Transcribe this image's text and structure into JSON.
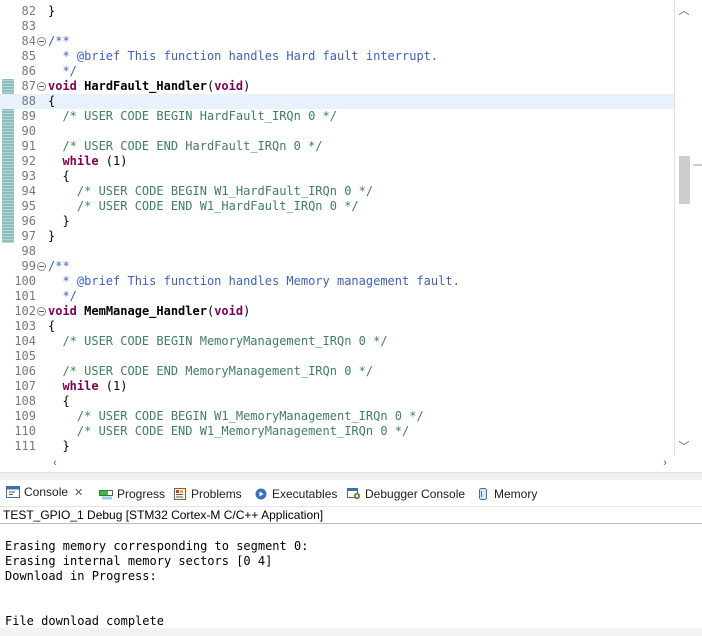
{
  "editor": {
    "lines": [
      {
        "n": "82",
        "fold": false,
        "current": false,
        "segs": [
          {
            "t": "}",
            "c": "plain"
          }
        ]
      },
      {
        "n": "83",
        "fold": false,
        "current": false,
        "segs": []
      },
      {
        "n": "84",
        "fold": true,
        "current": false,
        "segs": [
          {
            "t": "/**",
            "c": "doc"
          }
        ]
      },
      {
        "n": "85",
        "fold": false,
        "current": false,
        "segs": [
          {
            "t": "  * @brief This function handles Hard fault interrupt.",
            "c": "doc"
          }
        ]
      },
      {
        "n": "86",
        "fold": false,
        "current": false,
        "segs": [
          {
            "t": "  */",
            "c": "doc"
          }
        ]
      },
      {
        "n": "87",
        "fold": true,
        "current": false,
        "segs": [
          {
            "t": "void",
            "c": "kw"
          },
          {
            "t": " ",
            "c": "plain"
          },
          {
            "t": "HardFault_Handler",
            "c": "fn"
          },
          {
            "t": "(",
            "c": "plain"
          },
          {
            "t": "void",
            "c": "kw"
          },
          {
            "t": ")",
            "c": "plain"
          }
        ]
      },
      {
        "n": "88",
        "fold": false,
        "current": true,
        "segs": [
          {
            "t": "{",
            "c": "plain"
          }
        ]
      },
      {
        "n": "89",
        "fold": false,
        "current": false,
        "segs": [
          {
            "t": "  /* USER CODE BEGIN HardFault_IRQn 0 */",
            "c": "comment"
          }
        ]
      },
      {
        "n": "90",
        "fold": false,
        "current": false,
        "segs": []
      },
      {
        "n": "91",
        "fold": false,
        "current": false,
        "segs": [
          {
            "t": "  /* USER CODE END HardFault_IRQn 0 */",
            "c": "comment"
          }
        ]
      },
      {
        "n": "92",
        "fold": false,
        "current": false,
        "segs": [
          {
            "t": "  ",
            "c": "plain"
          },
          {
            "t": "while",
            "c": "kw"
          },
          {
            "t": " (1)",
            "c": "plain"
          }
        ]
      },
      {
        "n": "93",
        "fold": false,
        "current": false,
        "segs": [
          {
            "t": "  {",
            "c": "plain"
          }
        ]
      },
      {
        "n": "94",
        "fold": false,
        "current": false,
        "segs": [
          {
            "t": "    /* USER CODE BEGIN W1_HardFault_IRQn 0 */",
            "c": "comment"
          }
        ]
      },
      {
        "n": "95",
        "fold": false,
        "current": false,
        "segs": [
          {
            "t": "    /* USER CODE END W1_HardFault_IRQn 0 */",
            "c": "comment"
          }
        ]
      },
      {
        "n": "96",
        "fold": false,
        "current": false,
        "segs": [
          {
            "t": "  }",
            "c": "plain"
          }
        ]
      },
      {
        "n": "97",
        "fold": false,
        "current": false,
        "segs": [
          {
            "t": "}",
            "c": "plain"
          }
        ]
      },
      {
        "n": "98",
        "fold": false,
        "current": false,
        "segs": []
      },
      {
        "n": "99",
        "fold": true,
        "current": false,
        "segs": [
          {
            "t": "/**",
            "c": "doc"
          }
        ]
      },
      {
        "n": "100",
        "fold": false,
        "current": false,
        "segs": [
          {
            "t": "  * @brief This function handles Memory management fault.",
            "c": "doc"
          }
        ]
      },
      {
        "n": "101",
        "fold": false,
        "current": false,
        "segs": [
          {
            "t": "  */",
            "c": "doc"
          }
        ]
      },
      {
        "n": "102",
        "fold": true,
        "current": false,
        "segs": [
          {
            "t": "void",
            "c": "kw"
          },
          {
            "t": " ",
            "c": "plain"
          },
          {
            "t": "MemManage_Handler",
            "c": "fn"
          },
          {
            "t": "(",
            "c": "plain"
          },
          {
            "t": "void",
            "c": "kw"
          },
          {
            "t": ")",
            "c": "plain"
          }
        ]
      },
      {
        "n": "103",
        "fold": false,
        "current": false,
        "segs": [
          {
            "t": "{",
            "c": "plain"
          }
        ]
      },
      {
        "n": "104",
        "fold": false,
        "current": false,
        "segs": [
          {
            "t": "  /* USER CODE BEGIN MemoryManagement_IRQn 0 */",
            "c": "comment"
          }
        ]
      },
      {
        "n": "105",
        "fold": false,
        "current": false,
        "segs": []
      },
      {
        "n": "106",
        "fold": false,
        "current": false,
        "segs": [
          {
            "t": "  /* USER CODE END MemoryManagement_IRQn 0 */",
            "c": "comment"
          }
        ]
      },
      {
        "n": "107",
        "fold": false,
        "current": false,
        "segs": [
          {
            "t": "  ",
            "c": "plain"
          },
          {
            "t": "while",
            "c": "kw"
          },
          {
            "t": " (1)",
            "c": "plain"
          }
        ]
      },
      {
        "n": "108",
        "fold": false,
        "current": false,
        "segs": [
          {
            "t": "  {",
            "c": "plain"
          }
        ]
      },
      {
        "n": "109",
        "fold": false,
        "current": false,
        "segs": [
          {
            "t": "    /* USER CODE BEGIN W1_MemoryManagement_IRQn 0 */",
            "c": "comment"
          }
        ]
      },
      {
        "n": "110",
        "fold": false,
        "current": false,
        "segs": [
          {
            "t": "    /* USER CODE END W1_MemoryManagement_IRQn 0 */",
            "c": "comment"
          }
        ]
      },
      {
        "n": "111",
        "fold": false,
        "current": false,
        "segs": [
          {
            "t": "  }",
            "c": "plain"
          }
        ]
      }
    ]
  },
  "colors": {
    "comment": "#3f7f5f",
    "doc": "#3f5fbf",
    "keyword": "#7f0055",
    "current_line": "#e8f2fe",
    "change_bar": "#8fbfbd"
  },
  "tabs": [
    {
      "label": "Console",
      "icon": "console-icon",
      "active": true,
      "closable": true
    },
    {
      "label": "Progress",
      "icon": "progress-icon",
      "active": false
    },
    {
      "label": "Problems",
      "icon": "problems-icon",
      "active": false
    },
    {
      "label": "Executables",
      "icon": "executables-icon",
      "active": false
    },
    {
      "label": "Debugger Console",
      "icon": "debugger-console-icon",
      "active": false
    },
    {
      "label": "Memory",
      "icon": "memory-icon",
      "active": false
    }
  ],
  "console": {
    "title": "TEST_GPIO_1 Debug [STM32 Cortex-M C/C++ Application]",
    "lines": [
      "",
      "Erasing memory corresponding to segment 0:",
      "Erasing internal memory sectors [0 4]",
      "Download in Progress:",
      "",
      "",
      "File download complete"
    ]
  }
}
